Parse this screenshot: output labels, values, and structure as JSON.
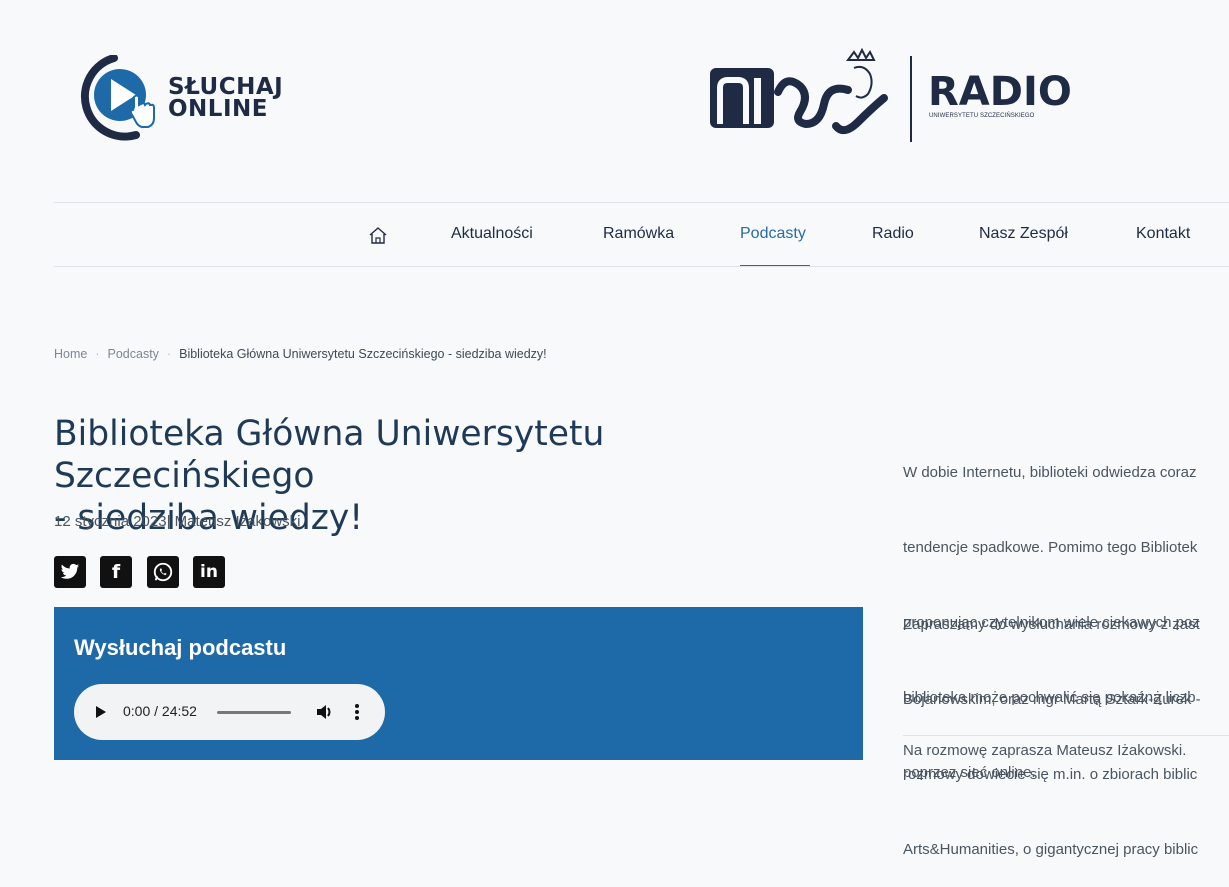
{
  "header": {
    "listen_logo": {
      "line1": "SŁUCHAJ",
      "line2": "ONLINE",
      "icon": "play-cursor-icon"
    },
    "brand": {
      "logo_text": "nius",
      "radio_word": "RADIO",
      "radio_sub": "UNIWERSYTETU SZCZECIŃSKIEGO"
    },
    "colors": {
      "brand": "#1f2a44",
      "accent": "#2a6aa6",
      "podcast_bg": "#1e6aa8"
    }
  },
  "nav": {
    "home_icon": "home-icon",
    "items": [
      {
        "label": "Aktualności"
      },
      {
        "label": "Ramówka"
      },
      {
        "label": "Podcasty",
        "active": true
      },
      {
        "label": "Radio"
      },
      {
        "label": "Nasz Zespół"
      },
      {
        "label": "Kontakt"
      }
    ]
  },
  "breadcrumb": {
    "items": [
      "Home",
      "Podcasty",
      "Biblioteka Główna Uniwersytetu Szczecińskiego - siedziba wiedzy!"
    ]
  },
  "article": {
    "title_line1": "Biblioteka Główna Uniwersytetu Szczecińskiego",
    "title_line2": "- siedziba wiedzy!",
    "meta": "12 stycznia 2023| Mateusz Iżakowski",
    "share_icons": [
      "twitter-icon",
      "facebook-icon",
      "whatsapp-icon",
      "linkedin-icon"
    ],
    "podcast": {
      "heading": "Wysłuchaj podcastu",
      "time": "0:00 / 24:52",
      "progress": 0
    }
  },
  "sidebar": {
    "para1": [
      "W dobie Internetu, biblioteki odwiedza coraz",
      "tendencje spadkowe. Pomimo tego Bibliotek",
      "proponując czytelnikom wiele ciekawych poz",
      "biblioteka może pochwalić się pokaźną liczb",
      "poprzez sieć online."
    ],
    "para2": [
      "Zapraszamy do wysłuchania rozmowy z zast",
      "Bojanowskim, oraz mgr Martą Sztark-Żurek -",
      "rozmowy dowiecie się m.in. o zbiorach biblic",
      "Arts&Humanities, o gigantycznej pracy biblic"
    ],
    "para3": [
      "Na rozmowę zaprasza Mateusz Iżakowski."
    ]
  }
}
